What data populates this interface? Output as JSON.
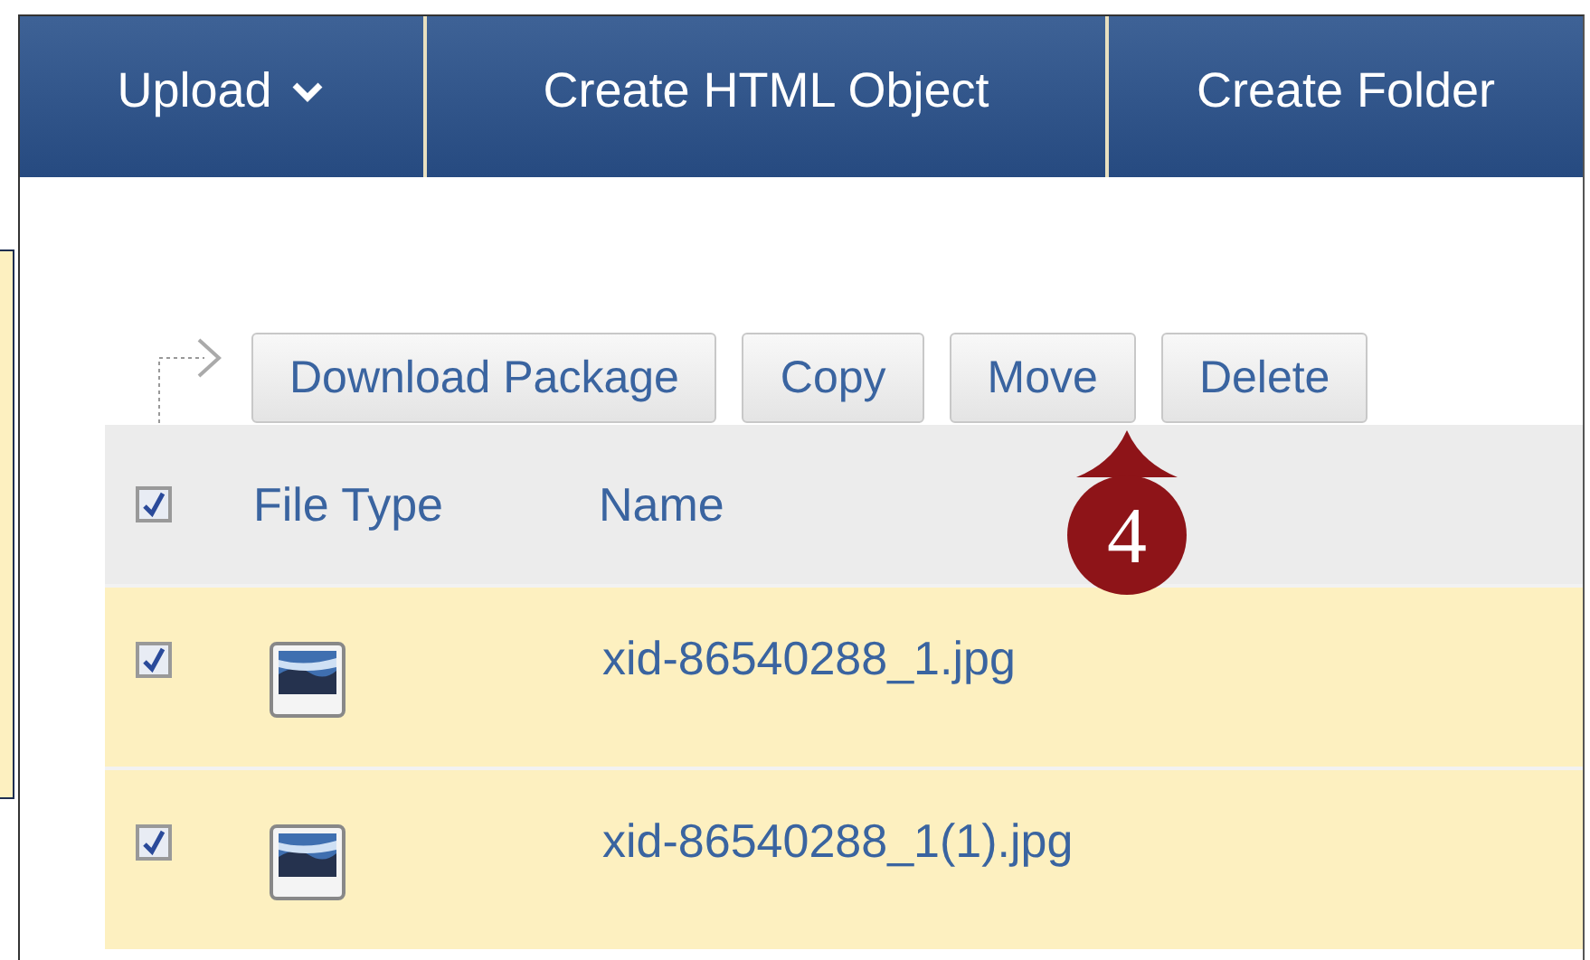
{
  "nav": [
    {
      "label": "Upload",
      "kind": "dropdown"
    },
    {
      "label": "Create HTML Object",
      "kind": "plain"
    },
    {
      "label": "Create Folder",
      "kind": "plain"
    }
  ],
  "actions": [
    "Download Package",
    "Copy",
    "Move",
    "Delete"
  ],
  "table": {
    "header_checked": true,
    "columns": [
      "File Type",
      "Name"
    ],
    "rows": [
      {
        "checked": true,
        "name": "xid-86540288_1.jpg"
      },
      {
        "checked": true,
        "name": "xid-86540288_1(1).jpg"
      }
    ]
  },
  "callout": {
    "number": "4"
  }
}
